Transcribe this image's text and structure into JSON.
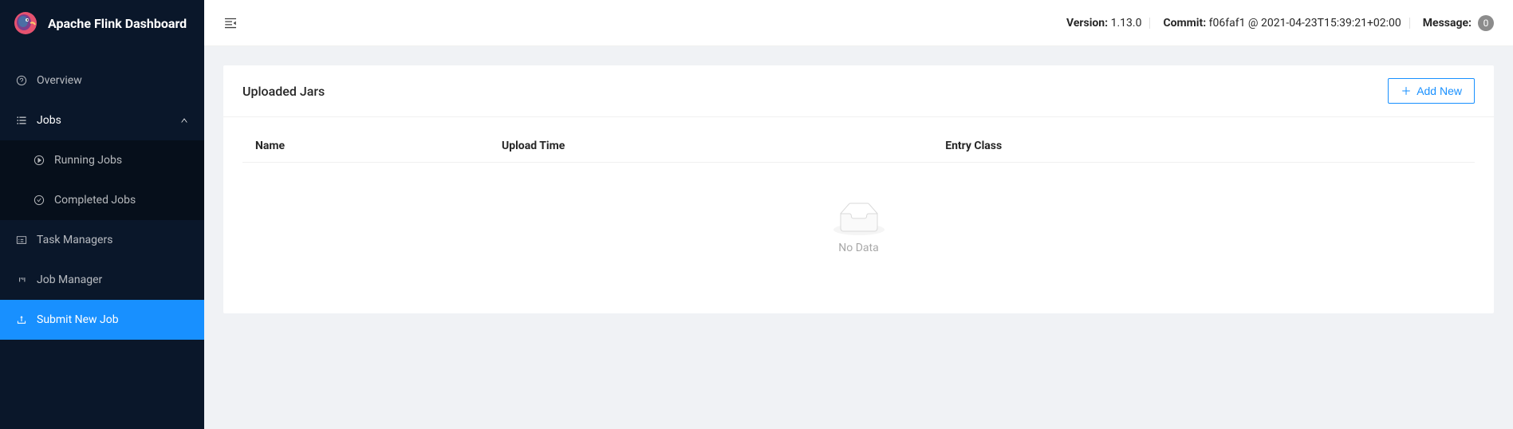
{
  "app": {
    "title": "Apache Flink Dashboard"
  },
  "header": {
    "version_label": "Version:",
    "version_value": "1.13.0",
    "commit_label": "Commit:",
    "commit_value": "f06faf1 @ 2021-04-23T15:39:21+02:00",
    "message_label": "Message:",
    "message_count": "0"
  },
  "sidebar": {
    "items": {
      "overview": "Overview",
      "jobs": "Jobs",
      "running_jobs": "Running Jobs",
      "completed_jobs": "Completed Jobs",
      "task_managers": "Task Managers",
      "job_manager": "Job Manager",
      "submit_new_job": "Submit New Job"
    }
  },
  "main": {
    "card_title": "Uploaded Jars",
    "add_button": "Add New",
    "table": {
      "columns": [
        "Name",
        "Upload Time",
        "Entry Class"
      ],
      "empty_text": "No Data"
    }
  }
}
